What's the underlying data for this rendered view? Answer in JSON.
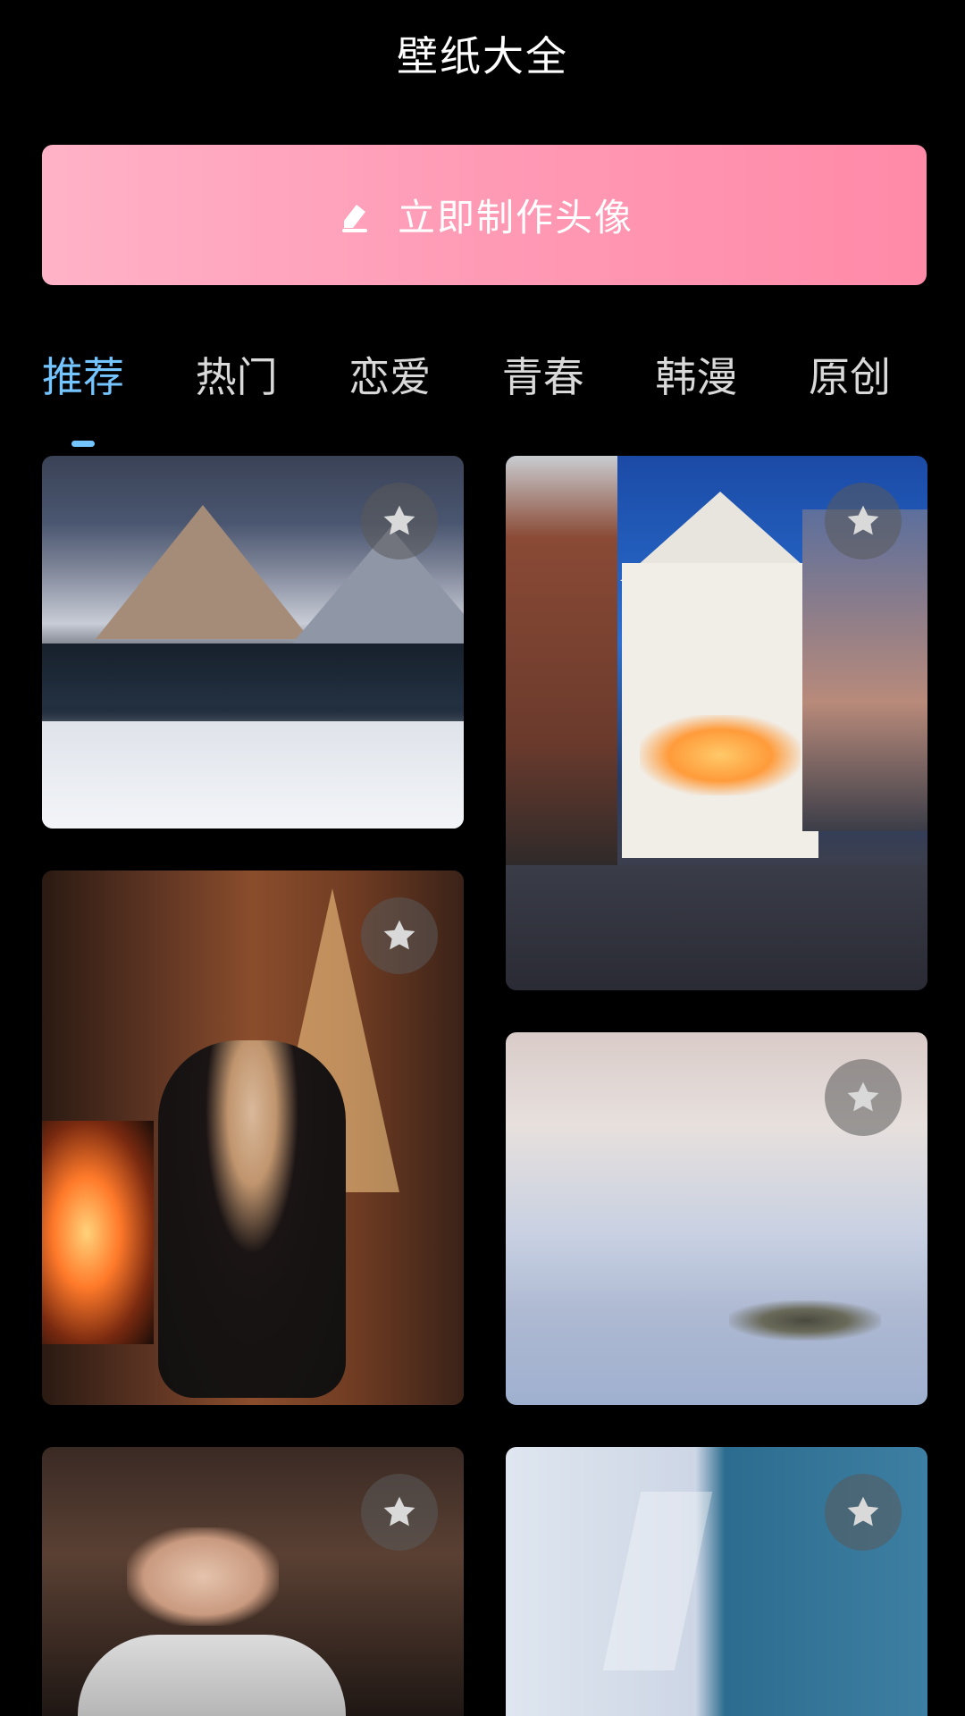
{
  "header": {
    "title": "壁纸大全"
  },
  "cta": {
    "label": "立即制作头像",
    "icon": "edit-icon"
  },
  "tabs": [
    {
      "label": "推荐",
      "active": true
    },
    {
      "label": "热门",
      "active": false
    },
    {
      "label": "恋爱",
      "active": false
    },
    {
      "label": "青春",
      "active": false
    },
    {
      "label": "韩漫",
      "active": false
    },
    {
      "label": "原创",
      "active": false
    }
  ],
  "colors": {
    "background": "#000000",
    "accent": "#73C4FF",
    "cta_gradient_start": "#FFB2C7",
    "cta_gradient_end": "#FF8AA8"
  },
  "wallpapers": [
    {
      "subject": "snowy mountains",
      "favorite_icon": "star-icon"
    },
    {
      "subject": "half-timbered house at night",
      "favorite_icon": "star-icon"
    },
    {
      "subject": "woman by fireplace and christmas tree",
      "favorite_icon": "star-icon"
    },
    {
      "subject": "sea of clouds",
      "favorite_icon": "star-icon"
    },
    {
      "subject": "hair washing salon",
      "favorite_icon": "star-icon"
    },
    {
      "subject": "shirts",
      "favorite_icon": "star-icon"
    }
  ]
}
